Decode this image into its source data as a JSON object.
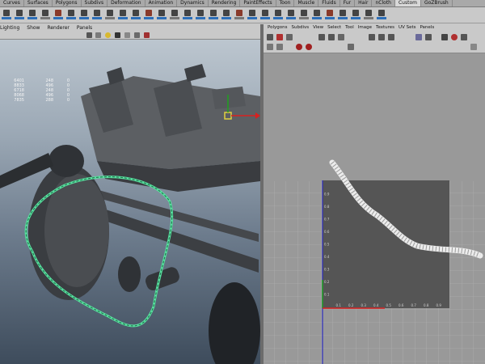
{
  "shelf": {
    "tabs": [
      "Curves",
      "Surfaces",
      "Polygons",
      "Subdivs",
      "Deformation",
      "Animation",
      "Dynamics",
      "Rendering",
      "PaintEffects",
      "Toon",
      "Muscle",
      "Fluids",
      "Fur",
      "Hair",
      "nCloth",
      "Custom",
      "GoZBrush"
    ],
    "active_tab": "Custom",
    "icons": [
      "brush-icon",
      "brush-icon",
      "brush-icon",
      "brush-icon",
      "brush-icon",
      "brush-icon",
      "brush-icon",
      "brush-icon",
      "brush-icon",
      "brush-icon",
      "brush-icon",
      "brush-icon",
      "brush-icon",
      "brush-icon",
      "brush-icon",
      "brush-icon",
      "brush-icon",
      "brush-icon",
      "brush-icon",
      "brush-icon",
      "brush-icon",
      "brush-icon",
      "brush-icon",
      "brush-icon",
      "brush-icon",
      "brush-icon",
      "brush-icon",
      "brush-icon",
      "brush-icon",
      "brush-icon"
    ]
  },
  "viewport_panel": {
    "menu": [
      "Lighting",
      "Show",
      "Renderer",
      "Panels"
    ],
    "hud": [
      {
        "a": "6401",
        "b": "248",
        "c": "0"
      },
      {
        "a": "8833",
        "b": "496",
        "c": "0"
      },
      {
        "a": "6718",
        "b": "248",
        "c": "0"
      },
      {
        "a": "8068",
        "b": "496",
        "c": "0"
      },
      {
        "a": "7835",
        "b": "288",
        "c": "0"
      }
    ]
  },
  "uv_panel": {
    "menu": [
      "Polygons",
      "Subdivs",
      "View",
      "Select",
      "Tool",
      "Image",
      "Textures",
      "UV Sets",
      "Panels"
    ],
    "axis_labels": [
      "0.1",
      "0.2",
      "0.3",
      "0.4",
      "0.5",
      "0.6",
      "0.7",
      "0.8",
      "0.9"
    ]
  },
  "colors": {
    "viewport_top": "#bcc6cf",
    "viewport_bottom": "#3e4c5c",
    "selection_green": "#59e0a0",
    "uv_texture_square": "#555555",
    "uv_grid_bg": "#999999",
    "axis_red": "#d82020",
    "axis_green": "#1fa01f",
    "axis_blue": "#3030c0"
  }
}
